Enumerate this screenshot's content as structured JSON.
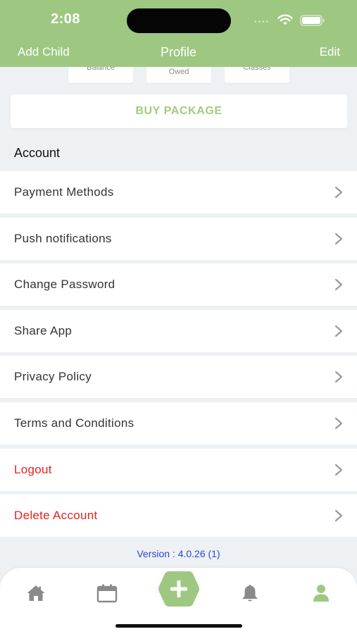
{
  "status_bar": {
    "time": "2:08"
  },
  "nav": {
    "left_label": "Add Child",
    "title": "Profile",
    "right_label": "Edit"
  },
  "stats": [
    {
      "label": "Balance"
    },
    {
      "label": "Owed"
    },
    {
      "label": "Classes"
    }
  ],
  "buy_package_label": "BUY PACKAGE",
  "section_title": "Account",
  "menu": [
    {
      "label": "Payment Methods",
      "danger": false
    },
    {
      "label": "Push notifications",
      "danger": false
    },
    {
      "label": "Change Password",
      "danger": false
    },
    {
      "label": "Share App",
      "danger": false
    },
    {
      "label": "Privacy Policy",
      "danger": false
    },
    {
      "label": "Terms and Conditions",
      "danger": false
    },
    {
      "label": "Logout",
      "danger": true
    },
    {
      "label": "Delete Account",
      "danger": true
    }
  ],
  "version_text": "Version : 4.0.26 (1)",
  "tabbar": {
    "tabs": [
      {
        "icon": "home-icon"
      },
      {
        "icon": "calendar-icon"
      },
      {
        "icon": "plus-icon"
      },
      {
        "icon": "bell-icon"
      },
      {
        "icon": "user-icon"
      }
    ]
  },
  "colors": {
    "header": "#9ec882",
    "accent": "#a3cb7f",
    "danger": "#e4231f",
    "version": "#2f45d8",
    "tab_inactive": "#8a8a8a",
    "tab_active": "#9ec882"
  }
}
